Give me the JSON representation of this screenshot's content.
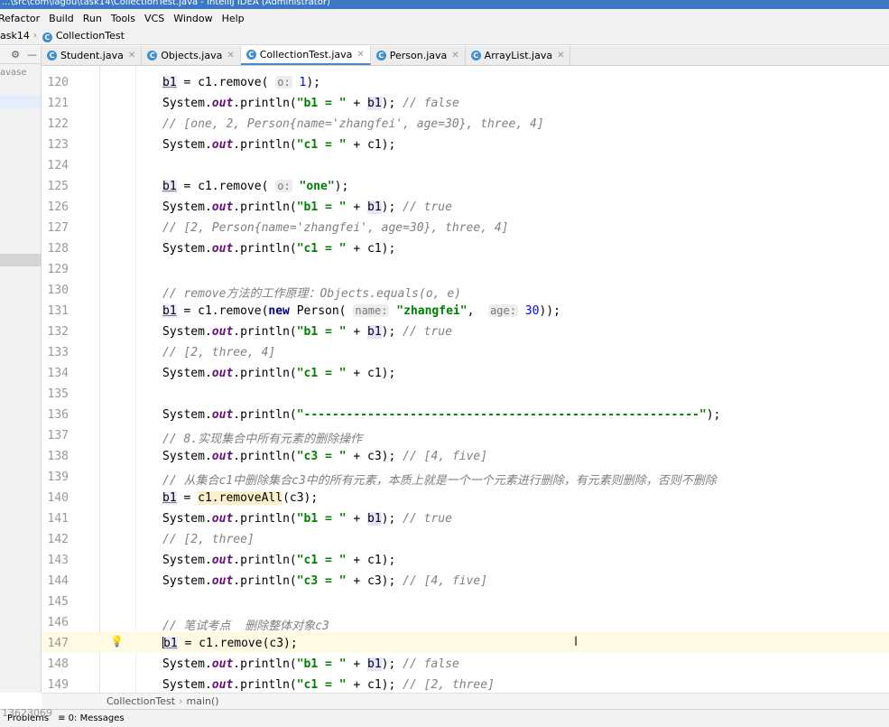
{
  "window": {
    "title": "...\\src\\com\\lagou\\task14\\CollectionTest.java - IntelliJ IDEA (Administrator)"
  },
  "menu": [
    "Refactor",
    "Build",
    "Run",
    "Tools",
    "VCS",
    "Window",
    "Help"
  ],
  "nav": {
    "module": "ask14",
    "file": "CollectionTest"
  },
  "side": {
    "label": "avase",
    "settings_icon": "gear-icon",
    "hide_icon": "minus-icon"
  },
  "tabs": [
    {
      "label": "Student.java",
      "icon": "class-icon",
      "active": false
    },
    {
      "label": "Objects.java",
      "icon": "class-icon",
      "active": false
    },
    {
      "label": "CollectionTest.java",
      "icon": "class-icon",
      "active": true
    },
    {
      "label": "Person.java",
      "icon": "class-icon",
      "active": false
    },
    {
      "label": "ArrayList.java",
      "icon": "class-icon",
      "active": false
    }
  ],
  "code": {
    "hints": {
      "o": "o:",
      "name": "name:",
      "age": "age:"
    },
    "lines": [
      {
        "no": "120"
      },
      {
        "no": "121"
      },
      {
        "no": "122"
      },
      {
        "no": "123"
      },
      {
        "no": "124"
      },
      {
        "no": "125"
      },
      {
        "no": "126"
      },
      {
        "no": "127"
      },
      {
        "no": "128"
      },
      {
        "no": "129"
      },
      {
        "no": "130"
      },
      {
        "no": "131"
      },
      {
        "no": "132"
      },
      {
        "no": "133"
      },
      {
        "no": "134"
      },
      {
        "no": "135"
      },
      {
        "no": "136"
      },
      {
        "no": "137"
      },
      {
        "no": "138"
      },
      {
        "no": "139"
      },
      {
        "no": "140"
      },
      {
        "no": "141"
      },
      {
        "no": "142"
      },
      {
        "no": "143"
      },
      {
        "no": "144"
      },
      {
        "no": "145"
      },
      {
        "no": "146"
      },
      {
        "no": "147"
      },
      {
        "no": "148"
      },
      {
        "no": "149"
      }
    ],
    "comments": {
      "c122": "// [one, 2, Person{name='zhangfei', age=30}, three, 4]",
      "c127": "// [2, Person{name='zhangfei', age=30}, three, 4]",
      "c130": "// remove方法的工作原理：Objects.equals(o, e)",
      "c133": "// [2, three, 4]",
      "c137": "// 8.实现集合中所有元素的删除操作",
      "c139": "// 从集合c1中删除集合c3中的所有元素，本质上就是一个一个元素进行删除，有元素则删除，否则不删除",
      "c142": "// [2, three]",
      "c146": "// 笔试考点  删除整体对象c3",
      "false": "// false",
      "true": "// true",
      "four_five": "// [4, five]",
      "two_three": "// [2, three]"
    },
    "strings": {
      "b1": "\"b1 = \"",
      "c1": "\"c1 = \"",
      "c3": "\"c3 = \"",
      "one": "\"one\"",
      "zhangfei": "\"zhangfei\"",
      "dashes": "\"--------------------------------------------------------\""
    }
  },
  "breadcrumb": {
    "class": "CollectionTest",
    "method": "main()"
  },
  "bottom": {
    "problems": "Problems",
    "messages": "0: Messages",
    "watermark": "13623069"
  }
}
